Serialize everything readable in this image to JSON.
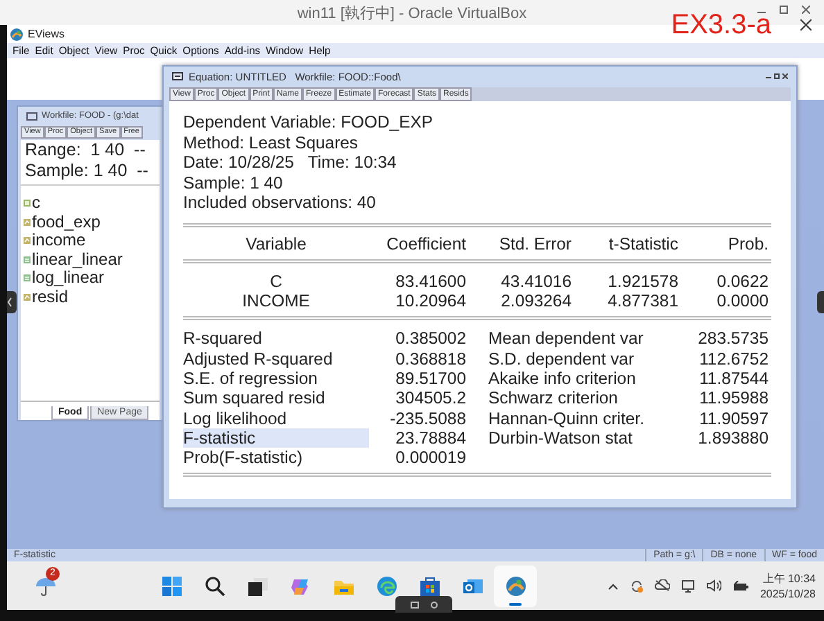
{
  "vm_window": {
    "title": "win11 [執行中] - Oracle VirtualBox",
    "annotation": "EX3.3-a"
  },
  "app": {
    "title": "EViews",
    "menu": [
      "File",
      "Edit",
      "Object",
      "View",
      "Proc",
      "Quick",
      "Options",
      "Add-ins",
      "Window",
      "Help"
    ]
  },
  "workfile": {
    "title": "Workfile: FOOD - (g:\\dat",
    "toolbar": [
      "View",
      "Proc",
      "Object",
      "Save",
      "Free"
    ],
    "range": "Range:  1 40  --",
    "sample": "Sample: 1 40  --",
    "objects": [
      {
        "name": "c",
        "kind": "coef"
      },
      {
        "name": "food_exp",
        "kind": "series"
      },
      {
        "name": "income",
        "kind": "series"
      },
      {
        "name": "linear_linear",
        "kind": "equation"
      },
      {
        "name": "log_linear",
        "kind": "equation"
      },
      {
        "name": "resid",
        "kind": "series"
      }
    ],
    "tabs": [
      {
        "label": "Food",
        "selected": true
      },
      {
        "label": "New Page",
        "selected": false
      }
    ]
  },
  "equation": {
    "title": "Equation: UNTITLED   Workfile: FOOD::Food\\",
    "toolbar": [
      "View",
      "Proc",
      "Object",
      "Print",
      "Name",
      "Freeze",
      "Estimate",
      "Forecast",
      "Stats",
      "Resids"
    ],
    "header_lines": [
      "Dependent Variable: FOOD_EXP",
      "Method: Least Squares",
      "Date: 10/28/25   Time: 10:34",
      "Sample: 1 40",
      "Included observations: 40"
    ],
    "columns": [
      "Variable",
      "Coefficient",
      "Std. Error",
      "t-Statistic",
      "Prob."
    ],
    "rows": [
      [
        "C",
        "83.41600",
        "43.41016",
        "1.921578",
        "0.0622"
      ],
      [
        "INCOME",
        "10.20964",
        "2.093264",
        "4.877381",
        "0.0000"
      ]
    ],
    "stats": [
      {
        "label": "R-squared",
        "value": "0.385002",
        "label_2": "Mean dependent var",
        "value_2": "283.5735",
        "selected": false
      },
      {
        "label": "Adjusted R-squared",
        "value": "0.368818",
        "label_2": "S.D. dependent var",
        "value_2": "112.6752",
        "selected": false
      },
      {
        "label": "S.E. of regression",
        "value": "89.51700",
        "label_2": "Akaike info criterion",
        "value_2": "11.87544",
        "selected": false
      },
      {
        "label": "Sum squared resid",
        "value": "304505.2",
        "label_2": "Schwarz criterion",
        "value_2": "11.95988",
        "selected": false
      },
      {
        "label": "Log likelihood",
        "value": "-235.5088",
        "label_2": "Hannan-Quinn criter.",
        "value_2": "11.90597",
        "selected": false
      },
      {
        "label": "F-statistic",
        "value": "23.78884",
        "label_2": "Durbin-Watson stat",
        "value_2": "1.893880",
        "selected": true
      },
      {
        "label": "Prob(F-statistic)",
        "value": "0.000019",
        "selected": false
      }
    ]
  },
  "status_bar": [
    "F-statistic",
    "Path = g:\\",
    "DB = none",
    "WF = food"
  ],
  "taskbar": {
    "weather_badge": "2",
    "apps": [
      {
        "kind": "start",
        "active": false
      },
      {
        "kind": "search",
        "active": false
      },
      {
        "kind": "taskview",
        "active": false
      },
      {
        "kind": "copilot",
        "active": false
      },
      {
        "kind": "folder",
        "active": false
      },
      {
        "kind": "edge",
        "active": false
      },
      {
        "kind": "store",
        "active": false
      },
      {
        "kind": "mail",
        "active": false
      },
      {
        "kind": "eviews",
        "active": true
      }
    ],
    "time": "上午 10:34",
    "date": "2025/10/28"
  }
}
